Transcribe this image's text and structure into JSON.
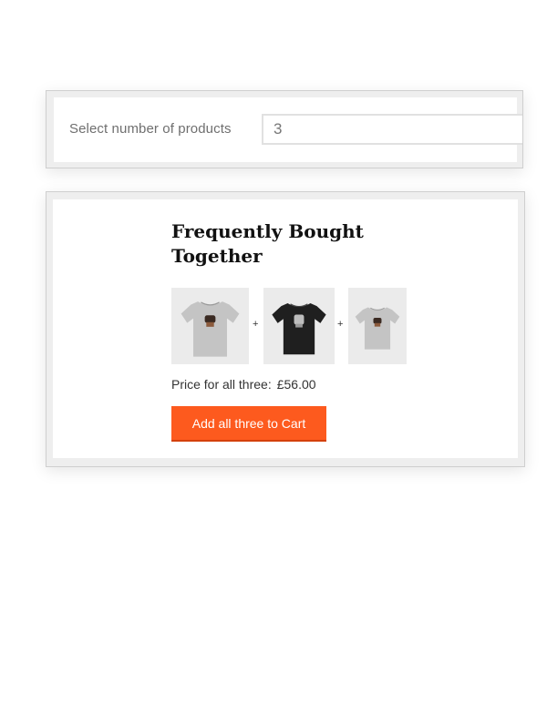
{
  "selector": {
    "label": "Select number of products",
    "value": "3"
  },
  "fbt": {
    "title": "Frequently Bought Together",
    "separator": "+",
    "products": [
      {
        "shirt_color": "#c4c4c4",
        "icon": "tshirt-icon"
      },
      {
        "shirt_color": "#1f1f1f",
        "icon": "tshirt-icon"
      },
      {
        "shirt_color": "#c4c4c4",
        "icon": "tshirt-icon"
      }
    ],
    "price_label": "Price for all three:",
    "price_value": "£56.00",
    "button_label": "Add all three to Cart",
    "button_color": "#fd5a1e"
  }
}
